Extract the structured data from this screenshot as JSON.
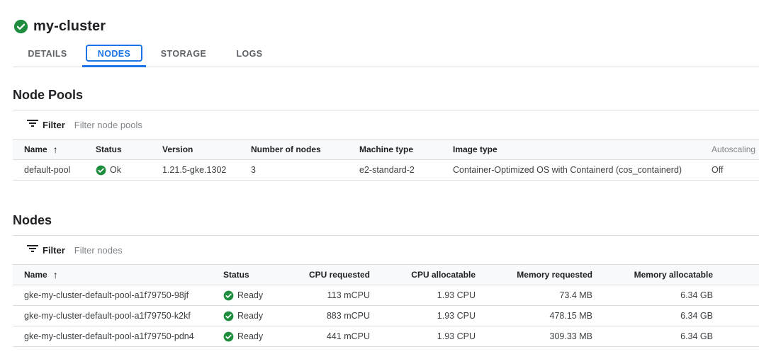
{
  "cluster": {
    "name": "my-cluster",
    "status_icon": "check-circle-icon",
    "status_color": "#1e8e3e"
  },
  "tabs": [
    {
      "label": "DETAILS",
      "active": false
    },
    {
      "label": "NODES",
      "active": true
    },
    {
      "label": "STORAGE",
      "active": false
    },
    {
      "label": "LOGS",
      "active": false
    }
  ],
  "accent_color": "#1a73e8",
  "node_pools": {
    "title": "Node Pools",
    "filter": {
      "label": "Filter",
      "placeholder": "Filter node pools",
      "icon": "filter-list-icon"
    },
    "columns": [
      "Name",
      "Status",
      "Version",
      "Number of nodes",
      "Machine type",
      "Image type",
      "Autoscaling"
    ],
    "sort_indicator": "↑",
    "rows": [
      {
        "name": "default-pool",
        "status": "Ok",
        "version": "1.21.5-gke.1302",
        "nodes": "3",
        "machine_type": "e2-standard-2",
        "image_type": "Container-Optimized OS with Containerd (cos_containerd)",
        "autoscaling": "Off"
      }
    ]
  },
  "nodes": {
    "title": "Nodes",
    "filter": {
      "label": "Filter",
      "placeholder": "Filter nodes",
      "icon": "filter-list-icon"
    },
    "columns": [
      "Name",
      "Status",
      "CPU requested",
      "CPU allocatable",
      "Memory requested",
      "Memory allocatable"
    ],
    "sort_indicator": "↑",
    "rows": [
      {
        "name": "gke-my-cluster-default-pool-a1f79750-98jf",
        "status": "Ready",
        "cpu_requested": "113 mCPU",
        "cpu_allocatable": "1.93 CPU",
        "mem_requested": "73.4 MB",
        "mem_allocatable": "6.34 GB"
      },
      {
        "name": "gke-my-cluster-default-pool-a1f79750-k2kf",
        "status": "Ready",
        "cpu_requested": "883 mCPU",
        "cpu_allocatable": "1.93 CPU",
        "mem_requested": "478.15 MB",
        "mem_allocatable": "6.34 GB"
      },
      {
        "name": "gke-my-cluster-default-pool-a1f79750-pdn4",
        "status": "Ready",
        "cpu_requested": "441 mCPU",
        "cpu_allocatable": "1.93 CPU",
        "mem_requested": "309.33 MB",
        "mem_allocatable": "6.34 GB"
      }
    ]
  }
}
